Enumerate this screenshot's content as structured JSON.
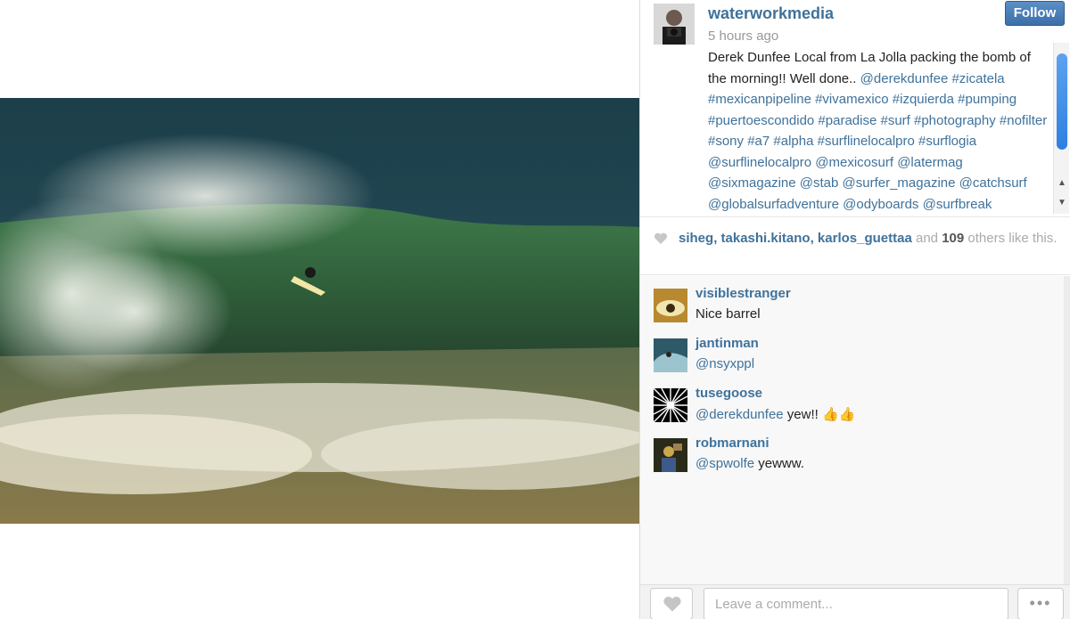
{
  "post": {
    "username": "waterworkmedia",
    "time": "5 hours ago",
    "follow_label": "Follow",
    "caption_text": "Derek Dunfee Local from La Jolla packing the bomb of the morning!! Well done.. ",
    "caption_tags": "@derekdunfee #zicatela #mexicanpipeline #vivamexico #izquierda #pumping #puertoescondido #paradise #surf #photography #nofilter #sony #a7 #alpha #surflinelocalpro #surflogia @surflinelocalpro @mexicosurf @latermag @sixmagazine @stab @surfer_magazine @catchsurf @globalsurfadventure @odyboards @surfbreak"
  },
  "likes": {
    "users": [
      "siheg",
      "takashi.kitano",
      "karlos_guettaa"
    ],
    "sep1": ", ",
    "sep2": ", ",
    "and": " and ",
    "count": "109",
    "suffix": " others like this."
  },
  "comments": [
    {
      "user": "visiblestranger",
      "text": "Nice barrel",
      "mention": ""
    },
    {
      "user": "jantinman",
      "text": "",
      "mention": "@nsyxppl"
    },
    {
      "user": "tusegoose",
      "text": " yew!! 👍👍",
      "mention": "@derekdunfee"
    },
    {
      "user": "robmarnani",
      "text": " yewww.",
      "mention": "@spwolfe"
    }
  ],
  "footer": {
    "comment_placeholder": "Leave a comment...",
    "more_label": "•••"
  },
  "icons": {
    "heart": "heart-icon",
    "more": "more-icon"
  },
  "colors": {
    "link": "#3f729b",
    "follow_button": "#3c6fa8"
  }
}
